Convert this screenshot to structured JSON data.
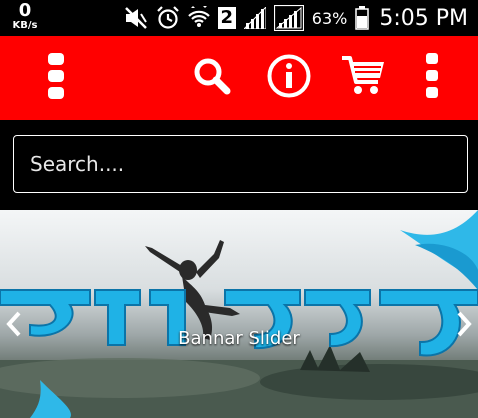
{
  "status_bar": {
    "net_speed": "0",
    "net_unit": "KB/s",
    "sim_label": "2",
    "battery_percent": "63%",
    "time": "5:05 PM",
    "icons": [
      "mute-icon",
      "alarm-icon",
      "wifi-icon",
      "sim-icon",
      "signal-icon",
      "signal-icon",
      "battery-icon"
    ]
  },
  "toolbar": {
    "background": "#ff0000",
    "icons": [
      "drawer-menu-icon",
      "search-icon",
      "info-icon",
      "cart-icon",
      "overflow-menu-icon"
    ]
  },
  "search": {
    "placeholder": "Search...."
  },
  "banner": {
    "caption": "Bannar Slider",
    "icons": [
      "chevron-left-icon",
      "chevron-right-icon"
    ]
  }
}
